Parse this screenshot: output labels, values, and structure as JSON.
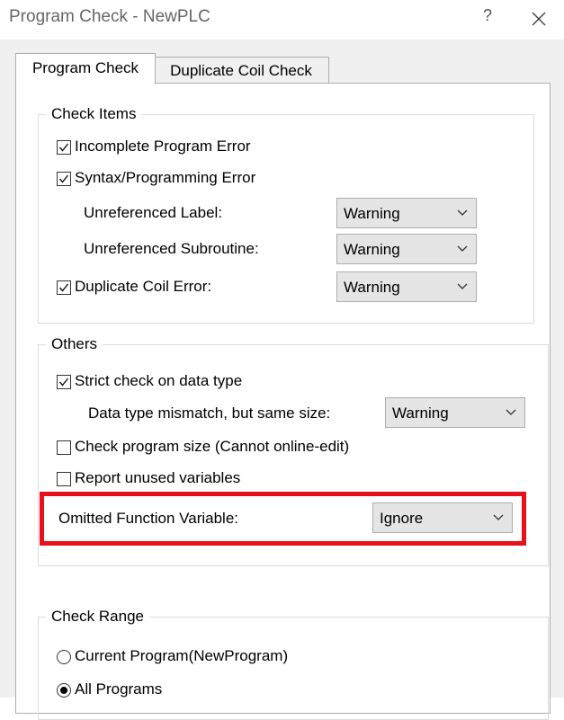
{
  "window": {
    "title": "Program Check - NewPLC",
    "help_label": "?"
  },
  "tabs": [
    {
      "label": "Program Check",
      "active": true
    },
    {
      "label": "Duplicate Coil Check",
      "active": false
    }
  ],
  "check_items": {
    "legend": "Check Items",
    "incomplete_program_error": {
      "label": "Incomplete Program Error",
      "checked": true
    },
    "syntax_programming_error": {
      "label": "Syntax/Programming Error",
      "checked": true
    },
    "unreferenced_label": {
      "label": "Unreferenced Label:",
      "value": "Warning"
    },
    "unreferenced_subroutine": {
      "label": "Unreferenced Subroutine:",
      "value": "Warning"
    },
    "duplicate_coil_error": {
      "label": "Duplicate Coil Error:",
      "checked": true,
      "value": "Warning"
    }
  },
  "others": {
    "legend": "Others",
    "strict_check": {
      "label": "Strict check on data type",
      "checked": true
    },
    "data_type_mismatch": {
      "label": "Data type mismatch, but same size:",
      "value": "Warning"
    },
    "check_program_size": {
      "label": "Check program size (Cannot online-edit)",
      "checked": false
    },
    "report_unused": {
      "label": "Report unused variables",
      "checked": false
    },
    "omitted_function_variable": {
      "label": "Omitted Function Variable:",
      "value": "Ignore",
      "highlight_color": "#e8101a"
    }
  },
  "check_range": {
    "legend": "Check Range",
    "options": [
      {
        "label": "Current Program(NewProgram)",
        "selected": false
      },
      {
        "label": "All Programs",
        "selected": true
      }
    ]
  },
  "colors": {
    "client_bg": "#f0f0f0",
    "combo_bg": "#e5e5e5",
    "highlight": "#e8101a"
  }
}
